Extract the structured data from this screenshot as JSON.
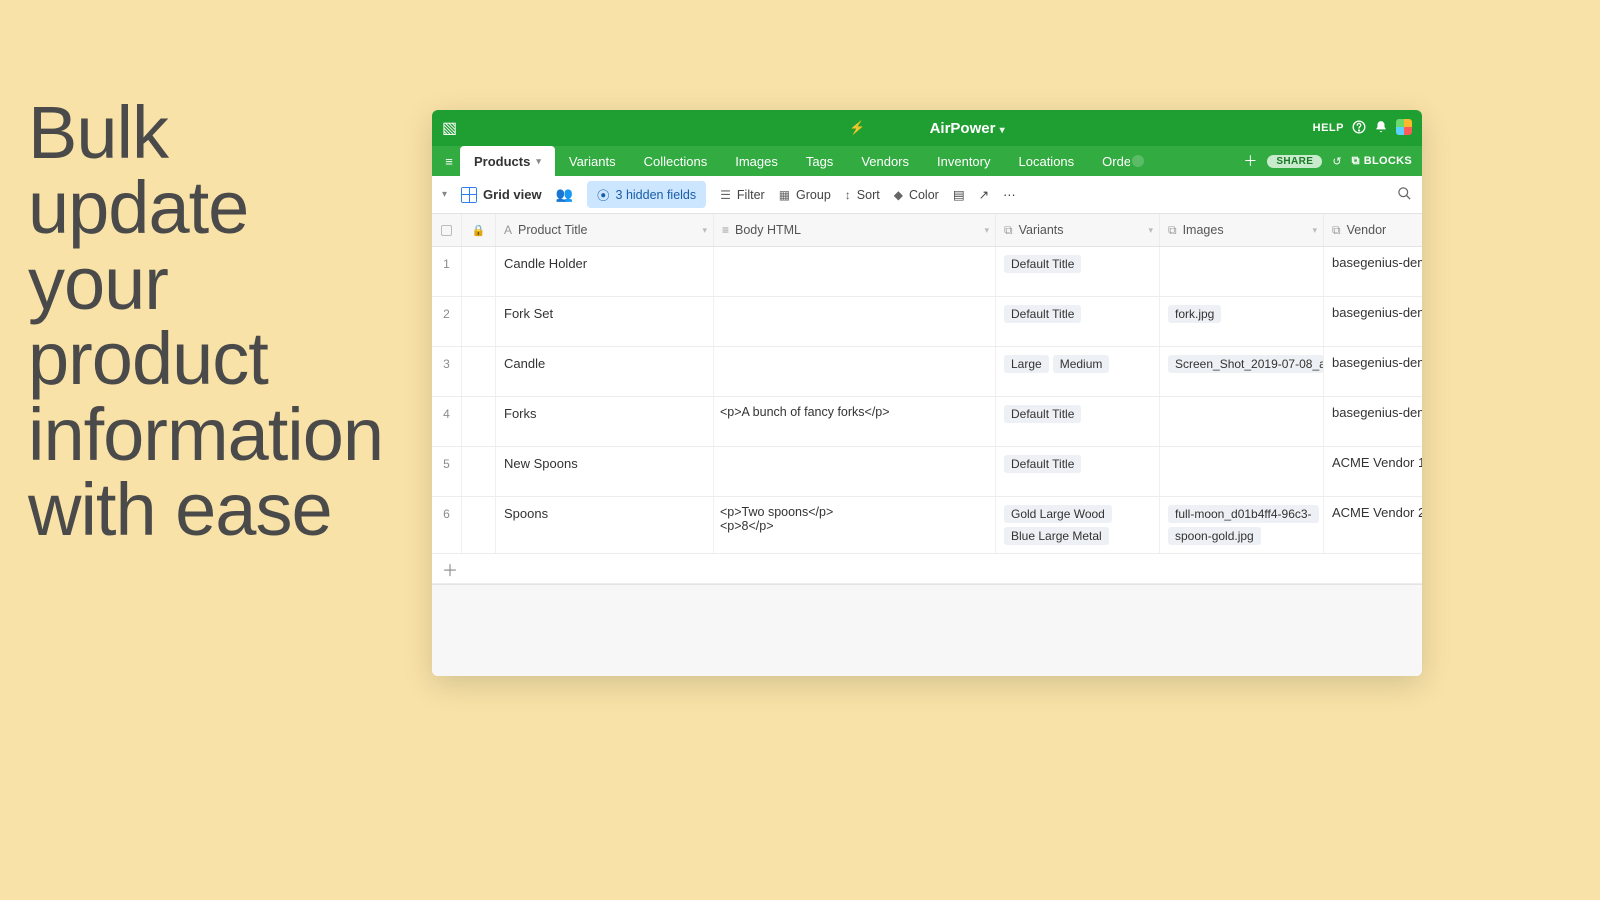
{
  "headline": "Bulk update your product information with ease",
  "topbar": {
    "title": "AirPower",
    "help_label": "HELP"
  },
  "tabs": {
    "items": [
      "Products",
      "Variants",
      "Collections",
      "Images",
      "Tags",
      "Vendors",
      "Inventory",
      "Locations",
      "Orders"
    ],
    "active": "Products",
    "share_label": "SHARE",
    "blocks_label": "BLOCKS"
  },
  "toolbar": {
    "view_label": "Grid view",
    "hidden_fields_label": "3 hidden fields",
    "filter_label": "Filter",
    "group_label": "Group",
    "sort_label": "Sort",
    "color_label": "Color"
  },
  "columns": {
    "product_title": "Product Title",
    "body_html": "Body HTML",
    "variants": "Variants",
    "images": "Images",
    "vendor": "Vendor"
  },
  "rows": [
    {
      "n": "1",
      "title": "Candle Holder",
      "body": "",
      "variants": [
        "Default Title"
      ],
      "images": [],
      "vendor": "basegenius-dem"
    },
    {
      "n": "2",
      "title": "Fork Set",
      "body": "",
      "variants": [
        "Default Title"
      ],
      "images": [
        "fork.jpg"
      ],
      "vendor": "basegenius-dem"
    },
    {
      "n": "3",
      "title": "Candle",
      "body": "",
      "variants": [
        "Large",
        "Medium"
      ],
      "images": [
        "Screen_Shot_2019-07-08_a"
      ],
      "vendor": "basegenius-dem"
    },
    {
      "n": "4",
      "title": "Forks",
      "body": "<p>A bunch of fancy forks</p>",
      "variants": [
        "Default Title"
      ],
      "images": [],
      "vendor": "basegenius-dem"
    },
    {
      "n": "5",
      "title": "New Spoons",
      "body": "",
      "variants": [
        "Default Title"
      ],
      "images": [],
      "vendor": "ACME Vendor 1"
    },
    {
      "n": "6",
      "title": "Spoons",
      "body": "<p>Two spoons</p>\n<p>8</p>",
      "variants": [
        "Gold Large Wood",
        "Blue Large Metal"
      ],
      "images": [
        "full-moon_d01b4ff4-96c3-",
        "spoon-gold.jpg"
      ],
      "vendor": "ACME Vendor 2"
    }
  ]
}
